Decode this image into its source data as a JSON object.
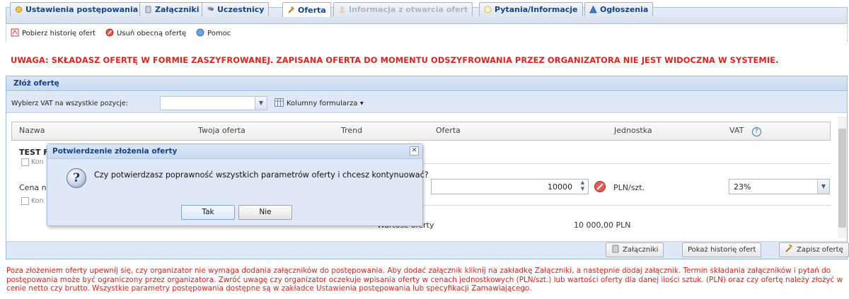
{
  "tabs": [
    {
      "label": "Ustawienia postępowania",
      "icon": "settings-icon",
      "state": "normal"
    },
    {
      "label": "Załączniki",
      "icon": "attachment-icon",
      "state": "normal"
    },
    {
      "label": "Uczestnicy",
      "icon": "users-icon",
      "state": "normal"
    },
    {
      "label": "Oferta",
      "icon": "gavel-icon",
      "state": "active"
    },
    {
      "label": "Informacja z otwarcia ofert",
      "icon": "person-icon",
      "state": "disabled"
    },
    {
      "label": "Pytania/Informacje",
      "icon": "question-icon",
      "state": "normal"
    },
    {
      "label": "Ogłoszenia",
      "icon": "announcement-icon",
      "state": "normal"
    }
  ],
  "toolbar": {
    "history": "Pobierz historię ofert",
    "delete": "Usuń obecną ofertę",
    "help": "Pomoc"
  },
  "warning": "UWAGA: SKŁADASZ OFERTĘ W FORMIE ZASZYFROWANEJ. ZAPISANA OFERTA DO MOMENTU ODSZYFROWANIA PRZEZ ORGANIZATORA NIE JEST WIDOCZNA W SYSTEMIE.",
  "panel": {
    "title": "Złóż ofertę",
    "vat_label": "Wybierz VAT na wszystkie pozycje:",
    "vat_value": "",
    "columns_label": "Kolumny formularza ▾"
  },
  "table": {
    "headers": {
      "name": "Nazwa",
      "your_offer": "Twoja oferta",
      "trend": "Trend",
      "offer": "Oferta",
      "unit": "Jednostka",
      "vat": "VAT"
    },
    "group_label": "TEST F",
    "checkbox_label_1": "Kon",
    "price_label": "Cena n",
    "checkbox_label_2": "Kon",
    "offer_value": "10000",
    "unit": "PLN/szt.",
    "vat": "23%",
    "total_label": "Wartość oferty",
    "total_value": "10 000,00 PLN"
  },
  "buttons": {
    "attachments": "Załączniki",
    "show_history": "Pokaż historię ofert",
    "save_offer": "Zapisz ofertę"
  },
  "info_text": "Poza złożeniem oferty upewnij się, czy organizator nie wymaga dodania załączników do postępowania. Aby dodać załącznik kliknij na zakładkę Załączniki, a następnie dodaj załącznik. Termin składania załączników i pytań do postępowania może być ograniczony przez organizatora. Zwróć uwagę czy organizator oczekuje wpisania oferty w cenach jednostkowych (PLN/szt.) lub wartości oferty dla danej ilości sztuk. (PLN) oraz czy ofertę należy złożyć w cenie netto czy brutto. Wszystkie parametry postępowania dostępne są w zakładce Ustawienia postępowania lub specyfikacji Zamawiającego.",
  "dialog": {
    "title": "Potwierdzenie złożenia oferty",
    "message": "Czy potwierdzasz poprawność wszystkich parametrów oferty i chcesz kontynuować?",
    "yes": "Tak",
    "no": "Nie",
    "icon": "question-icon"
  },
  "colors": {
    "warning": "#e2231a",
    "header_text": "#15428b",
    "panel_bg": "#dfe8f6"
  }
}
